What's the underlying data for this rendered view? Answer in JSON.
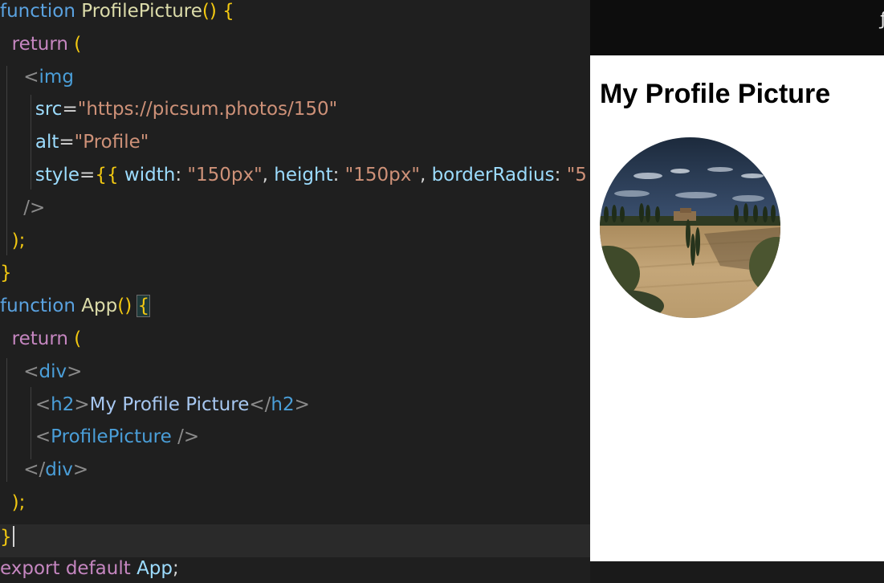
{
  "editor": {
    "lines": [
      {
        "tokens": [
          [
            "kw",
            "function"
          ],
          [
            "pun",
            " "
          ],
          [
            "fn",
            "ProfilePicture"
          ],
          [
            "yb",
            "()"
          ],
          [
            "pun",
            " "
          ],
          [
            "yb",
            "{"
          ]
        ]
      },
      {
        "tokens": [
          [
            "pun",
            "  "
          ],
          [
            "ret",
            "return"
          ],
          [
            "pun",
            " "
          ],
          [
            "yb",
            "("
          ]
        ]
      },
      {
        "tokens": [
          [
            "pun",
            "    "
          ],
          [
            "tagb",
            "<"
          ],
          [
            "tag",
            "img"
          ]
        ]
      },
      {
        "tokens": [
          [
            "pun",
            "      "
          ],
          [
            "attr",
            "src"
          ],
          [
            "pun",
            "="
          ],
          [
            "str",
            "\"https://picsum.photos/150\""
          ]
        ]
      },
      {
        "tokens": [
          [
            "pun",
            "      "
          ],
          [
            "attr",
            "alt"
          ],
          [
            "pun",
            "="
          ],
          [
            "str",
            "\"Profile\""
          ]
        ]
      },
      {
        "tokens": [
          [
            "pun",
            "      "
          ],
          [
            "attr",
            "style"
          ],
          [
            "pun",
            "="
          ],
          [
            "yb",
            "{{"
          ],
          [
            "pun",
            " "
          ],
          [
            "ident",
            "width"
          ],
          [
            "pun",
            ": "
          ],
          [
            "str",
            "\"150px\""
          ],
          [
            "pun",
            ", "
          ],
          [
            "ident",
            "height"
          ],
          [
            "pun",
            ": "
          ],
          [
            "str",
            "\"150px\""
          ],
          [
            "pun",
            ", "
          ],
          [
            "ident",
            "borderRadius"
          ],
          [
            "pun",
            ": "
          ],
          [
            "str",
            "\"5"
          ]
        ]
      },
      {
        "tokens": [
          [
            "pun",
            "    "
          ],
          [
            "tagb",
            "/>"
          ]
        ]
      },
      {
        "tokens": [
          [
            "pun",
            "  "
          ],
          [
            "yb",
            ");"
          ]
        ]
      },
      {
        "tokens": [
          [
            "yb",
            "}"
          ]
        ]
      },
      {
        "tokens": [
          [
            "kw",
            "function"
          ],
          [
            "pun",
            " "
          ],
          [
            "fn",
            "App"
          ],
          [
            "yb",
            "()"
          ],
          [
            "pun",
            " "
          ],
          [
            "yb",
            "{"
          ]
        ]
      },
      {
        "tokens": [
          [
            "pun",
            "  "
          ],
          [
            "ret",
            "return"
          ],
          [
            "pun",
            " "
          ],
          [
            "yb",
            "("
          ]
        ]
      },
      {
        "tokens": [
          [
            "pun",
            "    "
          ],
          [
            "tagb",
            "<"
          ],
          [
            "tag",
            "div"
          ],
          [
            "tagb",
            ">"
          ]
        ]
      },
      {
        "tokens": [
          [
            "pun",
            "      "
          ],
          [
            "tagb",
            "<"
          ],
          [
            "tag",
            "h2"
          ],
          [
            "tagb",
            ">"
          ],
          [
            "txt",
            "My Profile Picture"
          ],
          [
            "tagb",
            "</"
          ],
          [
            "tag",
            "h2"
          ],
          [
            "tagb",
            ">"
          ]
        ]
      },
      {
        "tokens": [
          [
            "pun",
            "      "
          ],
          [
            "tagb",
            "<"
          ],
          [
            "tag",
            "ProfilePicture"
          ],
          [
            "pun",
            " "
          ],
          [
            "tagb",
            "/>"
          ]
        ]
      },
      {
        "tokens": [
          [
            "pun",
            "    "
          ],
          [
            "tagb",
            "</"
          ],
          [
            "tag",
            "div"
          ],
          [
            "tagb",
            ">"
          ]
        ]
      },
      {
        "tokens": [
          [
            "pun",
            "  "
          ],
          [
            "yb",
            ");"
          ]
        ]
      },
      {
        "tokens": [
          [
            "yb",
            "}"
          ]
        ]
      },
      {
        "tokens": [
          [
            "ret",
            "export default"
          ],
          [
            "pun",
            " "
          ],
          [
            "ident",
            "App"
          ],
          [
            "pun",
            ";"
          ]
        ]
      }
    ],
    "current_line_index": 16,
    "boxed_bracket_line_index": 9
  },
  "preview": {
    "heading": "My Profile Picture",
    "image_alt": "Profile",
    "topbar_glyph": "ƒ"
  },
  "colors": {
    "editor_bg": "#1f1f1f",
    "preview_bg": "#ffffff",
    "keyword": "#5aa2e0",
    "bracket": "#f2c811",
    "return": "#c586c0",
    "string": "#ce9178",
    "attribute": "#9cdcfe"
  }
}
